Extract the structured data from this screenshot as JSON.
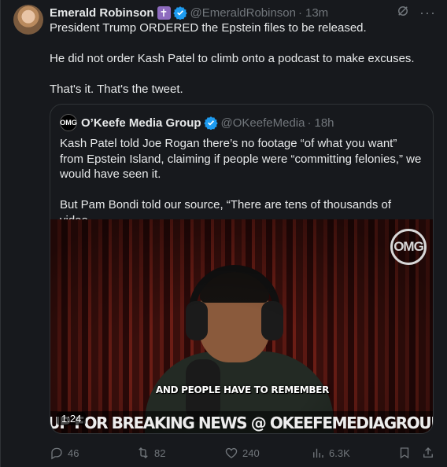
{
  "author": {
    "name": "Emerald Robinson",
    "badge_icon": "latin-cross-icon",
    "handle": "@EmeraldRobinson",
    "separator": "·",
    "time": "13m"
  },
  "tweet_lines": [
    "President Trump ORDERED the Epstein files to be released.",
    "",
    "He did not order Kash Patel to climb onto a podcast to make excuses.",
    "",
    "That's it. That's the tweet."
  ],
  "quote": {
    "name": "O’Keefe Media Group",
    "handle": "@OKeefeMedia",
    "separator": "·",
    "time": "18h",
    "lines": [
      "Kash Patel told Joe Rogan there’s no footage “of what you want” from Epstein Island, claiming if people were “committing felonies,” we would have seen it.",
      "",
      "But Pam Bondi told our source, “There are tens of thousands of video..."
    ],
    "video": {
      "logo_text": "OMG",
      "caption": "AND PEOPLE HAVE TO REMEMBER",
      "banner": "SIGN UP FOR BREAKING NEWS @ OKEEFEMEDIAGROUP.COM",
      "duration": "1:24"
    }
  },
  "actions": {
    "replies": "46",
    "reposts": "82",
    "likes": "240",
    "views": "6.3K"
  },
  "colors": {
    "background": "#17191d",
    "text": "#e7e9ea",
    "muted": "#71767b",
    "verified": "#1d9bf0"
  }
}
